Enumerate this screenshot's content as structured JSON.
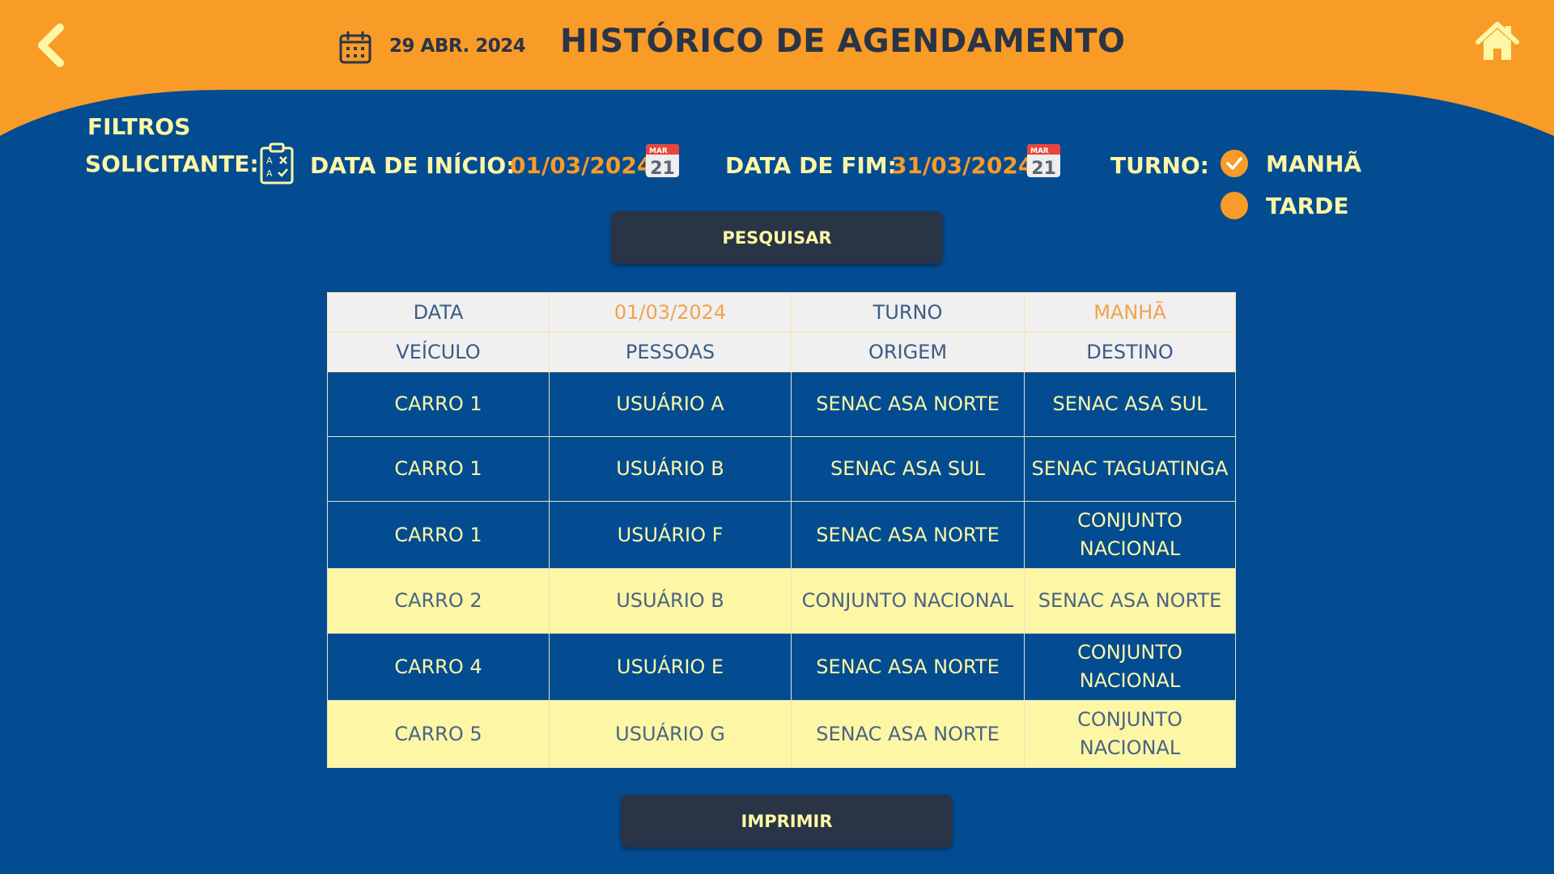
{
  "colors": {
    "background_blue": "#034c92",
    "header_orange": "#f99b27",
    "title_dark": "#2a3447",
    "label_yellow": "#fdf7a5",
    "value_orange": "#f99b27",
    "button_dark": "#293447",
    "highlight_row_yellow": "#fdf7a5",
    "table_header_gray": "#f0f0f0"
  },
  "header": {
    "back_icon": "chevron-left-icon",
    "date_icon": "calendar-icon",
    "date": "29 ABR. 2024",
    "title": "HISTÓRICO DE AGENDAMENTO",
    "home_icon": "home-icon"
  },
  "filters": {
    "title": "FILTROS",
    "requester_label": "SOLICITANTE:",
    "requester_icon": "clipboard-checklist-icon",
    "start_label": "DATA DE INÍCIO:",
    "start_value": "01/03/2024",
    "end_label": "DATA DE FIM:",
    "end_value": "31/03/2024",
    "calendar_icon": {
      "month": "MAR",
      "day": "21"
    },
    "shift_label": "TURNO:",
    "shift_options": [
      {
        "label": "MANHÃ",
        "checked": true
      },
      {
        "label": "TARDE",
        "checked": false
      }
    ]
  },
  "search_button": "PESQUISAR",
  "table": {
    "summary": {
      "date_label": "DATA",
      "date_value": "01/03/2024",
      "shift_label": "TURNO",
      "shift_value": "MANHÃ"
    },
    "columns": [
      "VEÍCULO",
      "PESSOAS",
      "ORIGEM",
      "DESTINO"
    ],
    "rows": [
      {
        "vehicle": "CARRO 1",
        "person": "USUÁRIO A",
        "origin": "SENAC ASA NORTE",
        "destination": "SENAC ASA SUL",
        "highlight": false
      },
      {
        "vehicle": "CARRO 1",
        "person": "USUÁRIO B",
        "origin": "SENAC ASA SUL",
        "destination": "SENAC TAGUATINGA",
        "highlight": false
      },
      {
        "vehicle": "CARRO 1",
        "person": "USUÁRIO F",
        "origin": "SENAC ASA NORTE",
        "destination": "CONJUNTO NACIONAL",
        "highlight": false
      },
      {
        "vehicle": "CARRO 2",
        "person": "USUÁRIO B",
        "origin": "CONJUNTO NACIONAL",
        "destination": "SENAC ASA NORTE",
        "highlight": true
      },
      {
        "vehicle": "CARRO 4",
        "person": "USUÁRIO E",
        "origin": "SENAC ASA NORTE",
        "destination": "CONJUNTO NACIONAL",
        "highlight": false
      },
      {
        "vehicle": "CARRO 5",
        "person": "USUÁRIO G",
        "origin": "SENAC ASA NORTE",
        "destination": "CONJUNTO NACIONAL",
        "highlight": true
      }
    ]
  },
  "print_button": "IMPRIMIR"
}
